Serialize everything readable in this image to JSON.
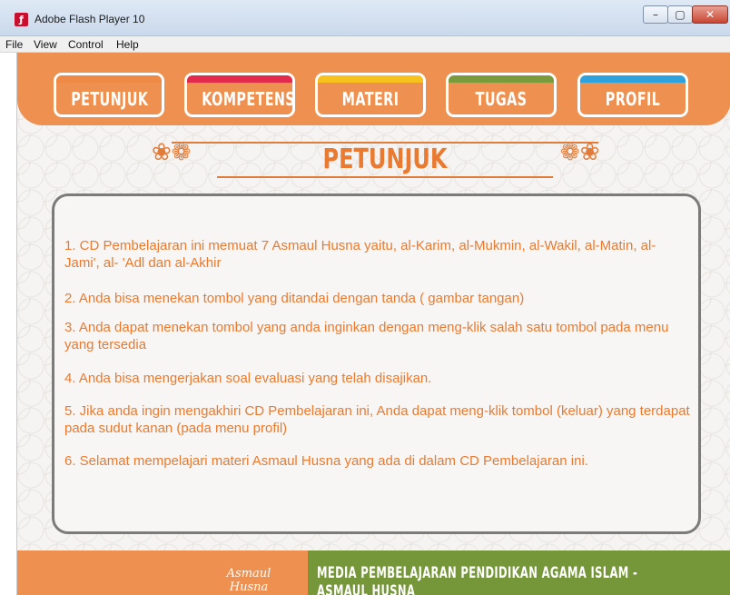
{
  "window": {
    "title": "Adobe Flash Player 10",
    "icon": "flash-icon",
    "controls": {
      "minimize": "–",
      "maximize": "▢",
      "close": "✕"
    }
  },
  "menubar": {
    "items": [
      "File",
      "View",
      "Control",
      "Help"
    ]
  },
  "nav": {
    "buttons": [
      {
        "label": "PETUNJUK",
        "color": "#ee8a45"
      },
      {
        "label": "KOMPETENSI",
        "color": "#e3294c"
      },
      {
        "label": "MATERI",
        "color": "#f6c21b"
      },
      {
        "label": "TUGAS",
        "color": "#7a9b3b"
      },
      {
        "label": "PROFIL",
        "color": "#2ea2dc"
      }
    ]
  },
  "section": {
    "title": "PETUNJUK"
  },
  "instructions": [
    {
      "text": "1. CD Pembelajaran ini memuat 7 Asmaul Husna yaitu, al-Karim, al-Mukmin, al-Wakil, al-Matin, al-Jami', al- 'Adl dan al-Akhir"
    },
    {
      "text": "2. Anda bisa menekan tombol yang ditandai dengan tanda ( gambar tangan)"
    },
    {
      "text": "3. Anda dapat menekan tombol yang anda inginkan dengan meng-klik salah satu tombol pada menu yang tersedia"
    },
    {
      "text": "4. Anda bisa mengerjakan soal evaluasi yang telah disajikan."
    },
    {
      "text": "5. Jika anda ingin mengakhiri CD Pembelajaran ini, Anda dapat meng-klik tombol (keluar) yang terdapat pada sudut kanan (pada menu profil)"
    },
    {
      "text": "6. Selamat mempelajari materi Asmaul Husna yang ada di dalam CD Pembelajaran ini."
    }
  ],
  "footer": {
    "logo": "Asmaul Husna",
    "text": "MEDIA PEMBELAJARAN PENDIDIKAN AGAMA ISLAM - ASMAUL HUSNA"
  },
  "colors": {
    "accent_orange": "#ee9050",
    "text_orange": "#ea7a2f",
    "footer_green": "#76963a"
  }
}
